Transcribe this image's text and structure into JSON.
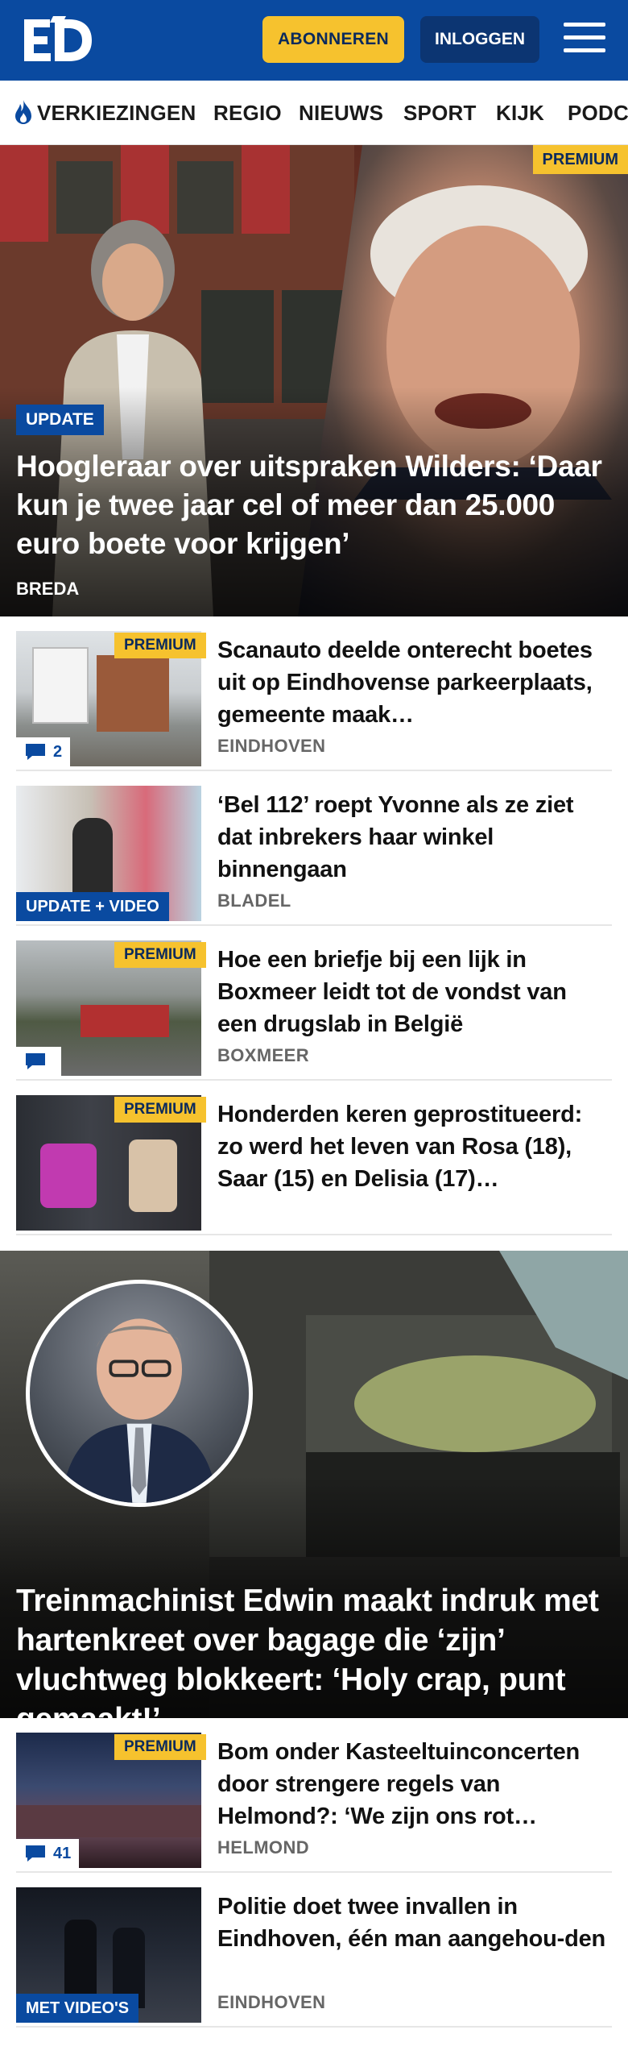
{
  "header": {
    "logo_text": "ED",
    "subscribe_label": "ABONNEREN",
    "login_label": "INLOGGEN",
    "menu_icon": "hamburger-menu-icon"
  },
  "nav": {
    "items": [
      {
        "label": "VERKIEZINGEN",
        "icon": "flame-icon"
      },
      {
        "label": "REGIO"
      },
      {
        "label": "NIEUWS"
      },
      {
        "label": "SPORT"
      },
      {
        "label": "KIJK"
      },
      {
        "label": "PODC"
      }
    ]
  },
  "hero": {
    "badge_premium": "PREMIUM",
    "badge_update": "UPDATE",
    "title": "Hoogleraar over uitspraken Wilders: ‘Daar kun je twee jaar cel of meer dan 25.000 euro boete voor krijgen’",
    "place": "BREDA"
  },
  "articles": [
    {
      "badge": "PREMIUM",
      "title": "Scanauto deelde onterecht boetes uit op Eindhovense parkeerplaats, gemeente maak…",
      "place": "EINDHOVEN",
      "comments": "2"
    },
    {
      "label": "UPDATE + VIDEO",
      "title": "‘Bel 112’ roept Yvonne als ze ziet dat inbrekers haar winkel binnengaan",
      "place": "BLADEL"
    },
    {
      "badge": "PREMIUM",
      "title": "Hoe een briefje bij een lijk in Boxmeer leidt tot de vondst van een drugslab in België",
      "place": "BOXMEER"
    },
    {
      "badge": "PREMIUM",
      "title": "Honderden keren geprostitueerd: zo werd het leven van Rosa (18), Saar (15) en Delisia (17)…"
    }
  ],
  "feature": {
    "title": "Treinmachinist Edwin maakt indruk met hartenkreet over bagage die ‘zijn’ vluchtweg blokkeert: ‘Holy crap, punt gemaakt!’"
  },
  "articles2": [
    {
      "badge": "PREMIUM",
      "title": "Bom onder Kasteeltuinconcerten door strengere regels van Helmond?: ‘We zijn ons rot…",
      "place": "HELMOND",
      "comments": "41"
    },
    {
      "label": "MET VIDEO'S",
      "title": "Politie doet twee invallen in Eindhoven, één man aangehou-den",
      "place": "EINDHOVEN"
    }
  ],
  "colors": {
    "brand_blue": "#0a4aa0",
    "premium_yellow": "#f6c22e",
    "dark_navy": "#0c3572"
  }
}
